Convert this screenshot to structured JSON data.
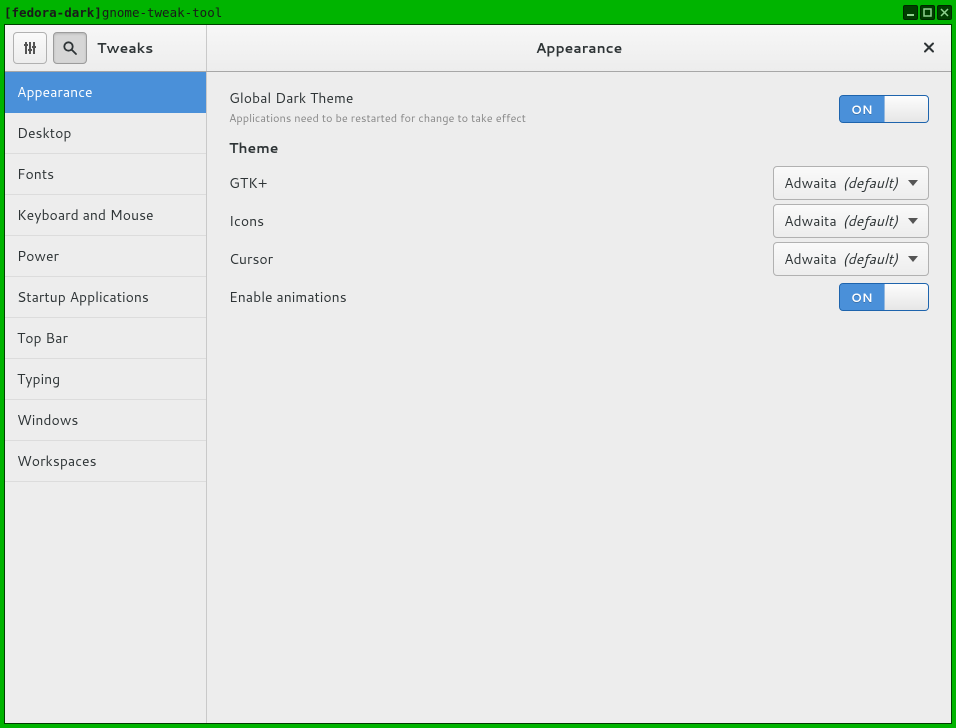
{
  "wm": {
    "title_bold": "[fedora-dark]",
    "title_rest": " gnome-tweak-tool"
  },
  "header": {
    "app_title": "Tweaks",
    "panel_title": "Appearance"
  },
  "sidebar": {
    "items": [
      {
        "label": "Appearance",
        "selected": true
      },
      {
        "label": "Desktop"
      },
      {
        "label": "Fonts"
      },
      {
        "label": "Keyboard and Mouse"
      },
      {
        "label": "Power"
      },
      {
        "label": "Startup Applications"
      },
      {
        "label": "Top Bar"
      },
      {
        "label": "Typing"
      },
      {
        "label": "Windows"
      },
      {
        "label": "Workspaces"
      }
    ]
  },
  "content": {
    "global_dark": {
      "label": "Global Dark Theme",
      "desc": "Applications need to be restarted for change to take effect",
      "switch": "ON"
    },
    "theme_heading": "Theme",
    "gtk": {
      "label": "GTK+",
      "value": "Adwaita",
      "suffix": "(default)"
    },
    "icons": {
      "label": "Icons",
      "value": "Adwaita",
      "suffix": "(default)"
    },
    "cursor": {
      "label": "Cursor",
      "value": "Adwaita",
      "suffix": "(default)"
    },
    "animations": {
      "label": "Enable animations",
      "switch": "ON"
    }
  }
}
